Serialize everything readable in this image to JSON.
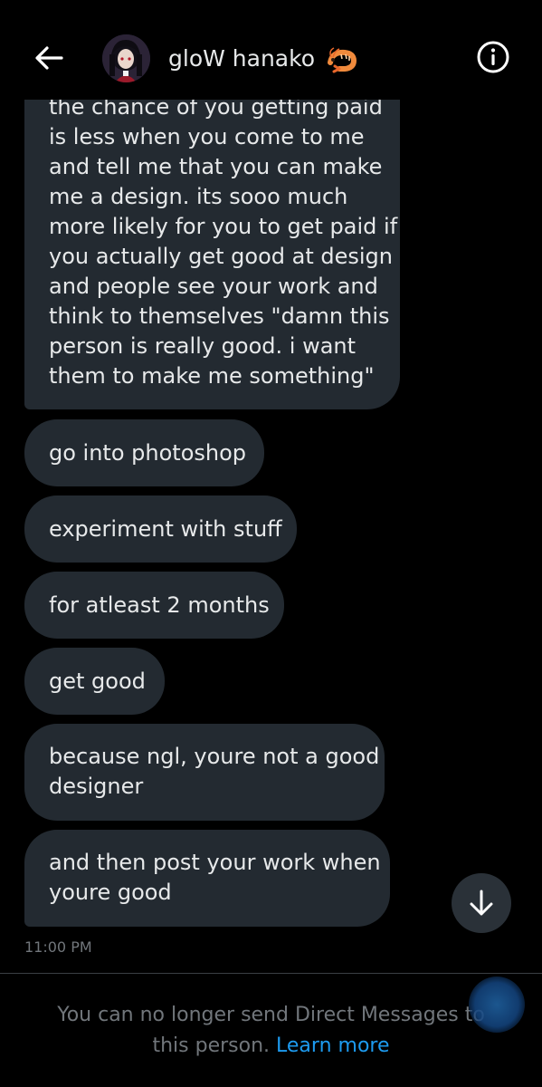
{
  "header": {
    "contact_name": "gloW hanako",
    "name_emoji": "🦐",
    "back_icon": "arrow-left-icon",
    "info_icon": "info-circle-icon"
  },
  "messages": {
    "long_message_lines": [
      "the chance of you getting paid",
      "is less when you come to me",
      "and tell me that you can make",
      "me a design. its sooo much",
      "more likely for you to get paid if",
      "you actually get good at design",
      "and people see your work and",
      "think to themselves \"damn this",
      "person is really good. i want",
      "them to make me something\""
    ],
    "m1": "go into photoshop",
    "m2": "experiment with stuff",
    "m3": "for atleast 2 months",
    "m4": "get good",
    "m5_line1": "because ngl, youre not a good",
    "m5_line2": "designer",
    "m6_line1": "and then post your work when",
    "m6_line2": "youre good"
  },
  "timestamp": "11:00 PM",
  "footer": {
    "notice_text": "You can no longer send Direct Messages to this person.",
    "learn_more": "Learn more"
  },
  "colors": {
    "background": "#000000",
    "bubble": "#232a31",
    "text": "#e7e9ea",
    "muted": "#71767b",
    "link": "#1d9bf0"
  }
}
